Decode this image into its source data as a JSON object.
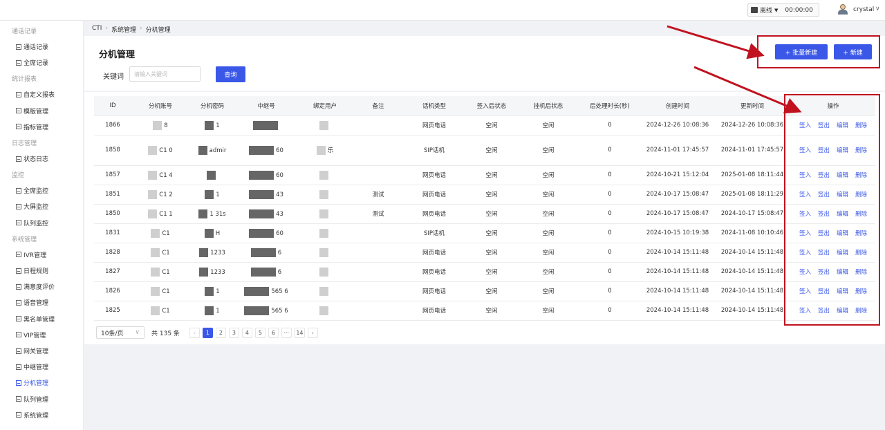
{
  "topbar": {
    "status_label": "离线",
    "timer": "00:00:00",
    "user_name": "crystal"
  },
  "sidebar": {
    "groups": [
      {
        "title": "通话记录",
        "items": [
          "通话记录",
          "全席记录"
        ]
      },
      {
        "title": "统计报表",
        "items": [
          "自定义报表",
          "模版管理",
          "指标管理"
        ]
      },
      {
        "title": "日志管理",
        "items": [
          "状态日志"
        ]
      },
      {
        "title": "监控",
        "items": [
          "全席监控",
          "大屏监控",
          "队列监控"
        ]
      },
      {
        "title": "系统管理",
        "items": [
          "IVR管理",
          "日程规则",
          "满意度评价",
          "语音管理",
          "黑名单管理",
          "VIP管理",
          "网关管理",
          "中继管理",
          "分机管理",
          "队列管理",
          "系统管理"
        ]
      }
    ]
  },
  "breadcrumb": [
    "CTI",
    "系统管理",
    "分机管理"
  ],
  "page": {
    "title": "分机管理",
    "keyword_label": "关键词",
    "keyword_placeholder": "请输入关键词",
    "query_label": "查询",
    "batch_new_label": "+ 批量新建",
    "new_label": "+ 新建"
  },
  "table": {
    "headers": [
      "ID",
      "分机账号",
      "分机密码",
      "中继号",
      "绑定用户",
      "备注",
      "话机类型",
      "签入后状态",
      "挂机后状态",
      "后处理时长(秒)",
      "创建时间",
      "更新时间",
      "操作"
    ],
    "actions": [
      "签入",
      "签出",
      "编辑",
      "删除"
    ],
    "rows": [
      {
        "id": "1866",
        "account": "8",
        "password": "1",
        "trunk": "",
        "user": "",
        "remark": "",
        "type": "网页电话",
        "login_status": "空闲",
        "hangup_status": "空闲",
        "wrap": "0",
        "created": "2024-12-26 10:08:36",
        "updated": "2024-12-26 10:08:36"
      },
      {
        "id": "1858",
        "account": "C1  0",
        "password": "admir",
        "trunk": "60",
        "user": "乐",
        "remark": "",
        "type": "SIP话机",
        "login_status": "空闲",
        "hangup_status": "空闲",
        "wrap": "0",
        "created": "2024-11-01 17:45:57",
        "updated": "2024-11-01 17:45:57"
      },
      {
        "id": "1857",
        "account": "C1  4",
        "password": "",
        "trunk": "60",
        "user": "",
        "remark": "",
        "type": "网页电话",
        "login_status": "空闲",
        "hangup_status": "空闲",
        "wrap": "0",
        "created": "2024-10-21 15:12:04",
        "updated": "2025-01-08 18:11:44"
      },
      {
        "id": "1851",
        "account": "C1  2",
        "password": "1",
        "trunk": "43",
        "user": "",
        "remark": "测试",
        "type": "网页电话",
        "login_status": "空闲",
        "hangup_status": "空闲",
        "wrap": "0",
        "created": "2024-10-17 15:08:47",
        "updated": "2025-01-08 18:11:29"
      },
      {
        "id": "1850",
        "account": "C1  1",
        "password": "1  31s",
        "trunk": "43",
        "user": "",
        "remark": "测试",
        "type": "网页电话",
        "login_status": "空闲",
        "hangup_status": "空闲",
        "wrap": "0",
        "created": "2024-10-17 15:08:47",
        "updated": "2024-10-17 15:08:47"
      },
      {
        "id": "1831",
        "account": "C1",
        "password": "H",
        "trunk": "60",
        "user": "",
        "remark": "",
        "type": "SIP话机",
        "login_status": "空闲",
        "hangup_status": "空闲",
        "wrap": "0",
        "created": "2024-10-15 10:19:38",
        "updated": "2024-11-08 10:10:46"
      },
      {
        "id": "1828",
        "account": "C1",
        "password": "1233",
        "trunk": "6",
        "user": "",
        "remark": "",
        "type": "网页电话",
        "login_status": "空闲",
        "hangup_status": "空闲",
        "wrap": "0",
        "created": "2024-10-14 15:11:48",
        "updated": "2024-10-14 15:11:48"
      },
      {
        "id": "1827",
        "account": "C1",
        "password": "1233",
        "trunk": "6",
        "user": "",
        "remark": "",
        "type": "网页电话",
        "login_status": "空闲",
        "hangup_status": "空闲",
        "wrap": "0",
        "created": "2024-10-14 15:11:48",
        "updated": "2024-10-14 15:11:48"
      },
      {
        "id": "1826",
        "account": "C1",
        "password": "1",
        "trunk": "565  6",
        "user": "",
        "remark": "",
        "type": "网页电话",
        "login_status": "空闲",
        "hangup_status": "空闲",
        "wrap": "0",
        "created": "2024-10-14 15:11:48",
        "updated": "2024-10-14 15:11:48"
      },
      {
        "id": "1825",
        "account": "C1",
        "password": "1",
        "trunk": "565  6",
        "user": "",
        "remark": "",
        "type": "网页电话",
        "login_status": "空闲",
        "hangup_status": "空闲",
        "wrap": "0",
        "created": "2024-10-14 15:11:48",
        "updated": "2024-10-14 15:11:48"
      }
    ]
  },
  "pager": {
    "page_size": "10条/页",
    "total": "共 135 条",
    "pages": [
      "1",
      "2",
      "3",
      "4",
      "5",
      "6",
      "···",
      "14"
    ],
    "current": "1"
  },
  "annotation_color": "#c1121f",
  "accent_color": "#3a57e8"
}
